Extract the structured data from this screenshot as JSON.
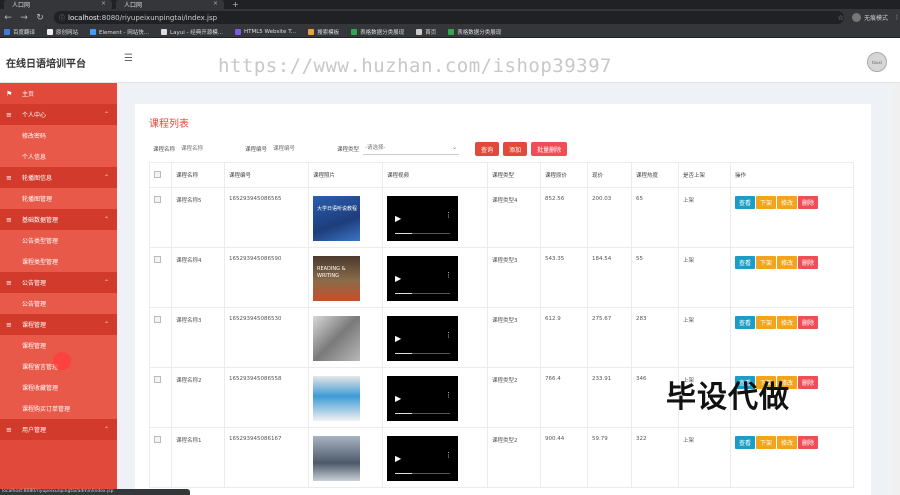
{
  "browser": {
    "tabs": [
      {
        "title": "人口网"
      },
      {
        "title": "人口网"
      }
    ],
    "url_host": "localhost",
    "url_path": ":8080/riyupeixunpingtai/index.jsp",
    "profile_name": "无痕模式",
    "bookmarks": [
      "百度翻译",
      "原创网站",
      "Element - 网站快...",
      "Layui - 经典开源模...",
      "HTML5 Website T...",
      "搜索模板",
      "表格数据分类展现",
      "首页",
      "表格数据分类展现"
    ],
    "status_url": "localhost:8080/riyupeixunpingtai/admin/index.jsp"
  },
  "header": {
    "brand": "在线日语培训平台",
    "watermark": "https://www.huzhan.com/ishop39397",
    "avatar_text": "touxi"
  },
  "sidebar": {
    "items": [
      {
        "label": "主页",
        "type": "top"
      },
      {
        "label": "个人中心",
        "type": "group"
      },
      {
        "label": "修改密码",
        "type": "sub"
      },
      {
        "label": "个人信息",
        "type": "sub"
      },
      {
        "label": "轮播图信息",
        "type": "group"
      },
      {
        "label": "轮播图管理",
        "type": "sub"
      },
      {
        "label": "基础数据管理",
        "type": "group"
      },
      {
        "label": "公告类型管理",
        "type": "sub"
      },
      {
        "label": "课程类型管理",
        "type": "sub"
      },
      {
        "label": "公告管理",
        "type": "group"
      },
      {
        "label": "公告管理",
        "type": "sub"
      },
      {
        "label": "课程管理",
        "type": "group"
      },
      {
        "label": "课程管理",
        "type": "sub"
      },
      {
        "label": "课程留言管理",
        "type": "sub"
      },
      {
        "label": "课程收藏管理",
        "type": "sub"
      },
      {
        "label": "课程购买订单管理",
        "type": "sub"
      },
      {
        "label": "用户管理",
        "type": "group"
      }
    ]
  },
  "main": {
    "title": "课程列表",
    "search": {
      "name_label": "课程名称",
      "name_placeholder": "课程名称",
      "code_label": "课程编号",
      "code_placeholder": "课程编号",
      "type_label": "课程类型",
      "type_value": "-请选择-",
      "query_button": "查询",
      "add_button": "添加",
      "batch_delete_button": "批量删除"
    },
    "columns": [
      "课程名称",
      "课程编号",
      "课程照片",
      "课程视频",
      "课程类型",
      "课程原价",
      "现价",
      "课程热度",
      "是否上架",
      "操作"
    ],
    "rows": [
      {
        "name": "课程名称5",
        "code": "165293945086565",
        "type": "课程类型4",
        "orig_price": "852.56",
        "price": "200.03",
        "heat": "65",
        "listed": "上架",
        "photo_text": "大学日语听说教程"
      },
      {
        "name": "课程名称4",
        "code": "165293945086590",
        "type": "课程类型3",
        "orig_price": "543.35",
        "price": "184.54",
        "heat": "55",
        "listed": "上架",
        "photo_text": "READING & WRITING"
      },
      {
        "name": "课程名称3",
        "code": "165293945086530",
        "type": "课程类型3",
        "orig_price": "612.9",
        "price": "275.67",
        "heat": "283",
        "listed": "上架",
        "photo_text": ""
      },
      {
        "name": "课程名称2",
        "code": "165293945086558",
        "type": "课程类型2",
        "orig_price": "766.4",
        "price": "233.91",
        "heat": "346",
        "listed": "上架",
        "photo_text": ""
      },
      {
        "name": "课程名称1",
        "code": "165293945086167",
        "type": "课程类型2",
        "orig_price": "900.44",
        "price": "59.79",
        "heat": "322",
        "listed": "上架",
        "photo_text": ""
      }
    ],
    "row_actions": {
      "view": "查看",
      "off": "下架",
      "edit": "修改",
      "delete": "删除"
    }
  },
  "overlay_text": "毕设代做"
}
